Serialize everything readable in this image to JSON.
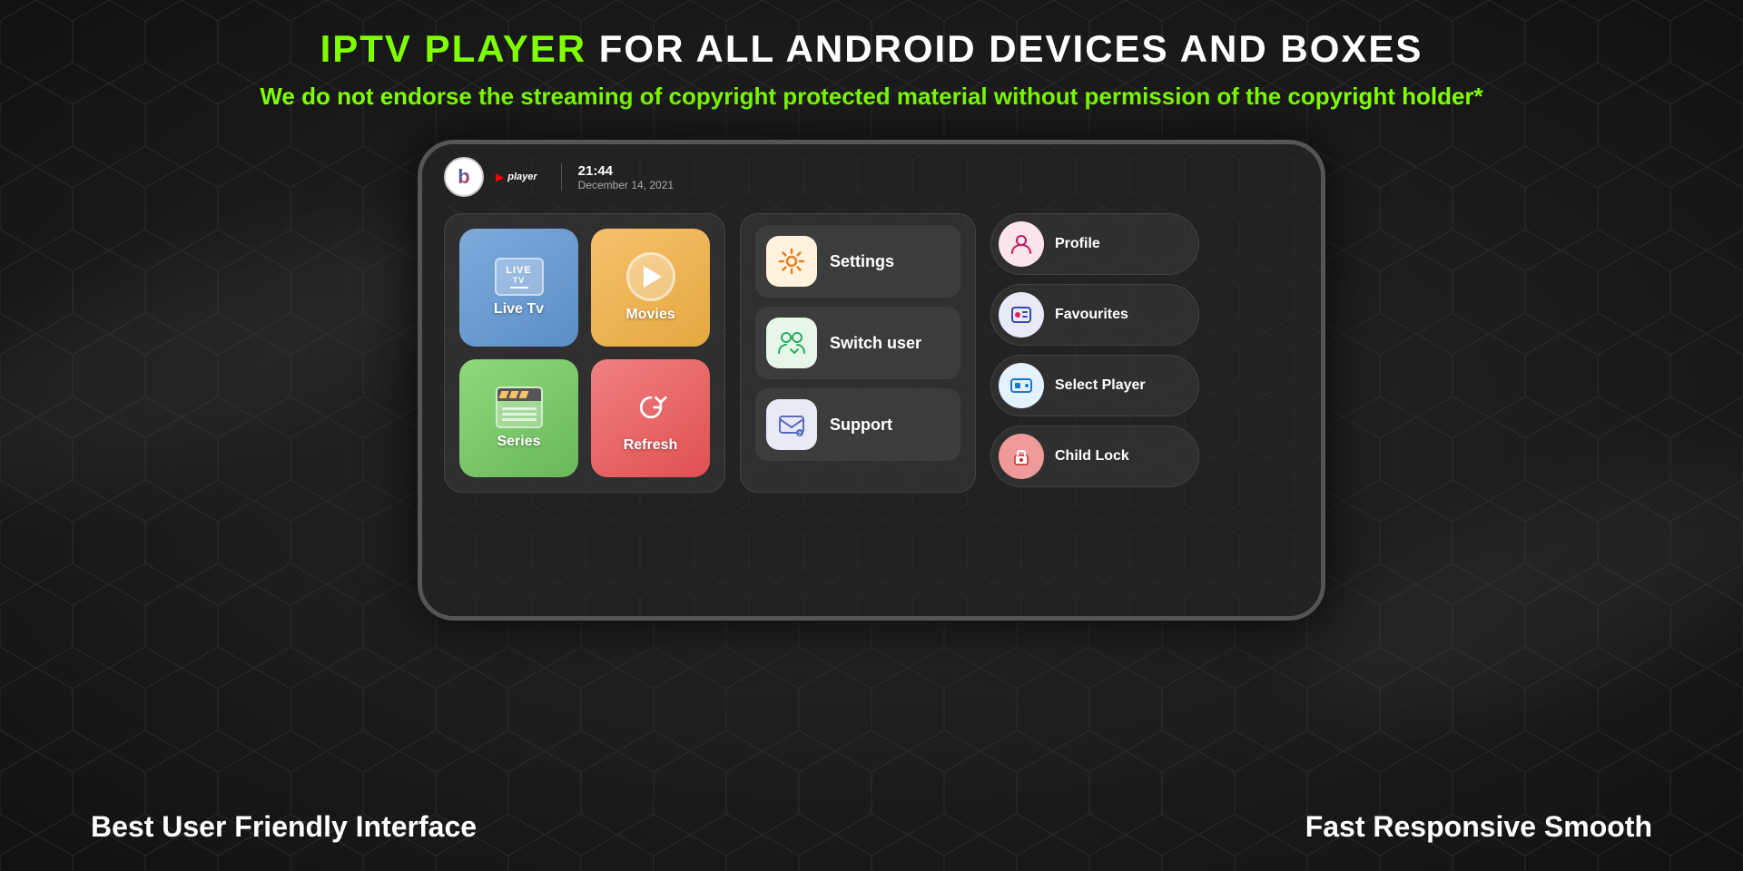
{
  "header": {
    "title_part1": "IPTV PLAYER",
    "title_part2": " FOR ALL ANDROID DEVICES AND BOXES",
    "subtitle": "We do not endorse the streaming of copyright protected material without permission of the copyright holder*"
  },
  "device": {
    "logo_b": "b",
    "logo_player": "player",
    "time": "21:44",
    "date": "December 14, 2021"
  },
  "apps": [
    {
      "id": "live-tv",
      "label": "Live Tv",
      "color": "live"
    },
    {
      "id": "movies",
      "label": "Movies",
      "color": "movies"
    },
    {
      "id": "series",
      "label": "Series",
      "color": "series"
    },
    {
      "id": "refresh",
      "label": "Refresh",
      "color": "refresh"
    }
  ],
  "menu": [
    {
      "id": "settings",
      "label": "Settings",
      "icon": "gear"
    },
    {
      "id": "switch-user",
      "label": "Switch user",
      "icon": "users"
    },
    {
      "id": "support",
      "label": "Support",
      "icon": "mail"
    }
  ],
  "right_panel": [
    {
      "id": "profile",
      "label": "Profile",
      "icon": "person"
    },
    {
      "id": "favourites",
      "label": "Favourites",
      "icon": "fav"
    },
    {
      "id": "select-player",
      "label": "Select Player",
      "icon": "player"
    },
    {
      "id": "child-lock",
      "label": "Child Lock",
      "icon": "lock"
    }
  ],
  "footer": {
    "left": "Best User Friendly Interface",
    "right": "Fast Responsive Smooth"
  }
}
